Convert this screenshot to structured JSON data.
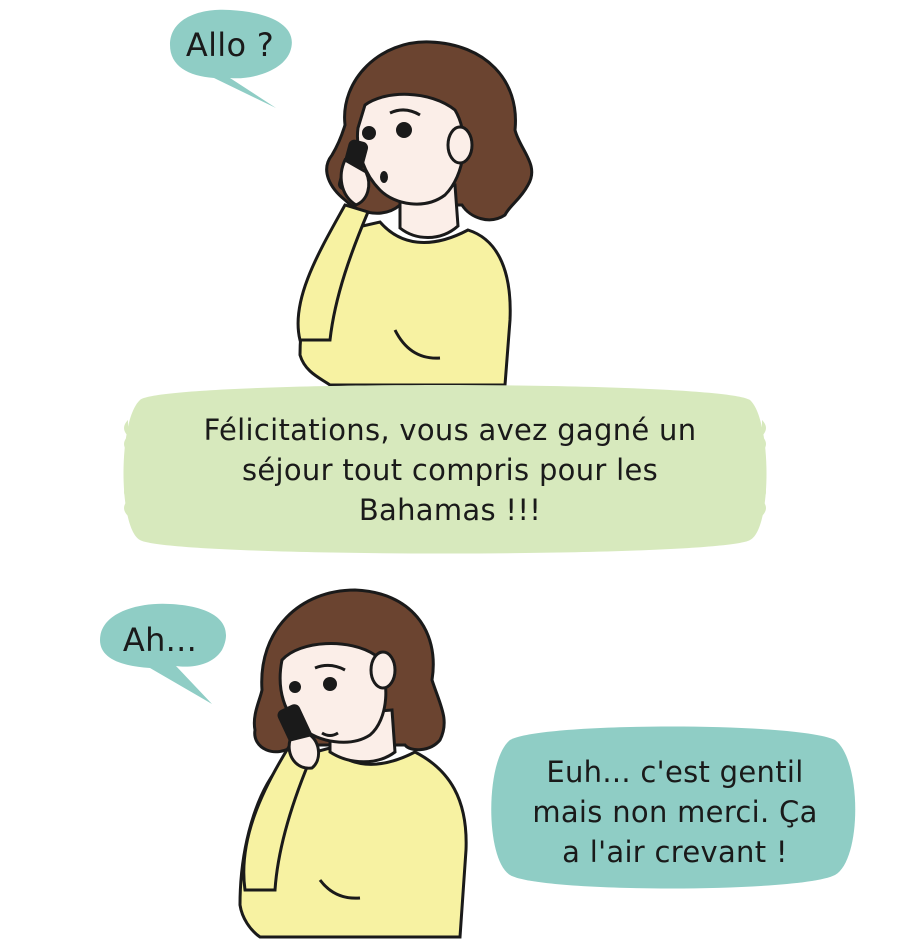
{
  "panel_top": {
    "speech_bubble": "Allo ?",
    "caller_bubble_lines": [
      "Félicitations, vous avez gagné un",
      "séjour tout compris pour les",
      "Bahamas !!!"
    ]
  },
  "panel_bottom": {
    "speech_bubble": "Ah...",
    "reply_bubble_lines": [
      "Euh... c'est gentil",
      "mais non merci. Ça",
      "a l'air crevant !"
    ]
  },
  "colors": {
    "speech_bubble": "#8fcdc5",
    "caller_bubble": "#d7e9bd",
    "sweater": "#f7f2a2",
    "hair": "#6b4430",
    "skin": "#fbeee8",
    "outline": "#1a1a1a"
  }
}
